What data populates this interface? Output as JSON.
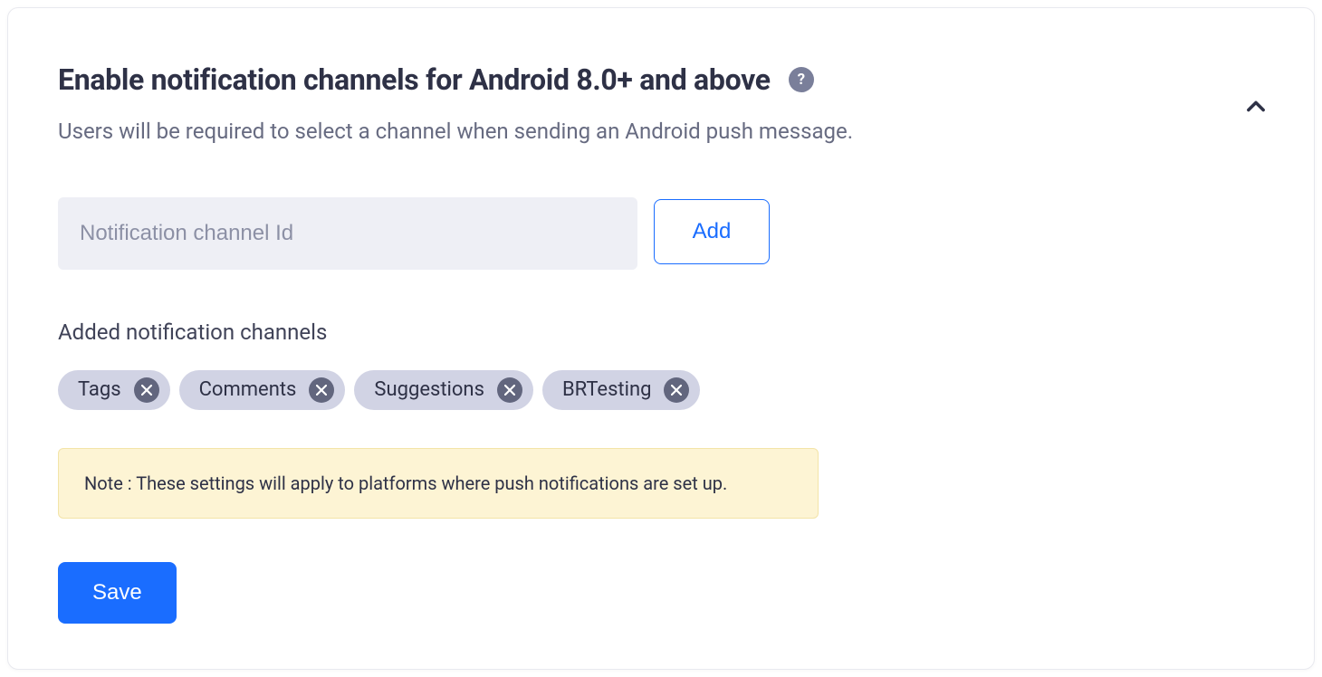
{
  "header": {
    "title": "Enable notification channels for Android 8.0+ and above",
    "subtitle": "Users will be required to select a channel when sending an Android push message."
  },
  "input": {
    "placeholder": "Notification channel Id",
    "add_label": "Add"
  },
  "added_section": {
    "label": "Added notification channels",
    "chips": [
      "Tags",
      "Comments",
      "Suggestions",
      "BRTesting"
    ]
  },
  "note": {
    "text": "Note : These settings will apply to platforms where push notifications are set up."
  },
  "actions": {
    "save_label": "Save"
  }
}
